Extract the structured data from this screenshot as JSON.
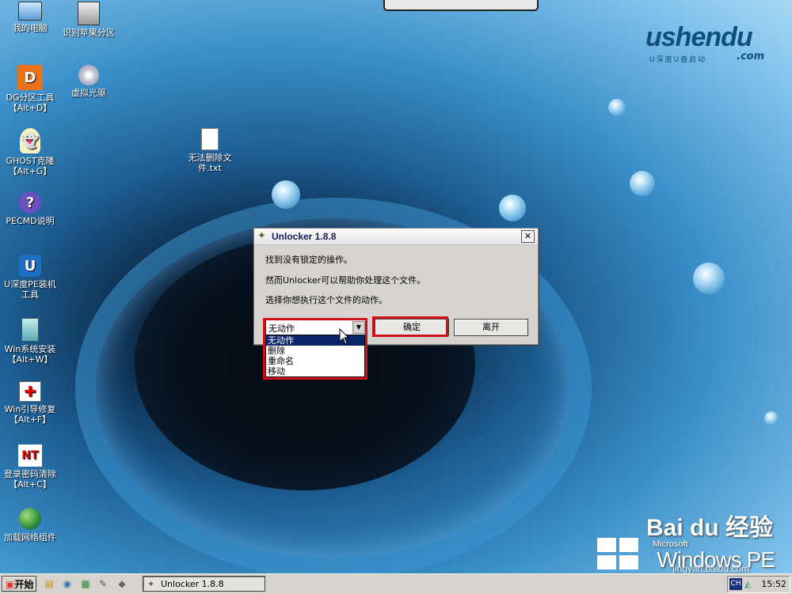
{
  "desktop": {
    "icons": [
      {
        "label1": "我的电脑",
        "label2": ""
      },
      {
        "label1": "识别苹果分区",
        "label2": ""
      },
      {
        "label1": "DG分区工具",
        "label2": "【Alt+D】"
      },
      {
        "label1": "虚拟光驱",
        "label2": ""
      },
      {
        "label1": "GHOST克隆",
        "label2": "【Alt+G】"
      },
      {
        "label1": "无法删除文",
        "label2": "件.txt"
      },
      {
        "label1": "PECMD说明",
        "label2": ""
      },
      {
        "label1": "U深度PE装机",
        "label2": "工具"
      },
      {
        "label1": "Win系统安装",
        "label2": "【Alt+W】"
      },
      {
        "label1": "Win引导修复",
        "label2": "【Alt+F】"
      },
      {
        "label1": "登录密码清除",
        "label2": "【Alt+C】"
      },
      {
        "label1": "加载网络组件",
        "label2": ""
      }
    ]
  },
  "logo": {
    "word": "ushendu",
    "com": ".com",
    "sub": "U深度U盘启动"
  },
  "dialog": {
    "title": "Unlocker 1.8.8",
    "close": "✕",
    "msg1": "找到没有锁定的操作。",
    "msg2": "然而Unlocker可以帮助你处理这个文件。",
    "msg3": "选择你想执行这个文件的动作。",
    "select_value": "无动作",
    "options": [
      "无动作",
      "删除",
      "重命名",
      "移动"
    ],
    "ok": "确定",
    "leave": "离开"
  },
  "taskbar": {
    "start": "开始",
    "task": "Unlocker 1.8.8",
    "lang": "CH",
    "clock": "15:52"
  },
  "watermark": {
    "brand": "Bai du 经验",
    "line1": "Microsoft",
    "line2": "Windows PE",
    "url": "jingyan.baidu.com"
  }
}
